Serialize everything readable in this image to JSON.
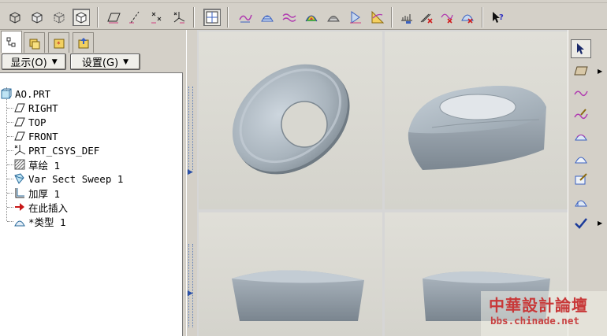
{
  "toolbar": {
    "icons": [
      "view-iso-icon",
      "view-shade-icon",
      "view-wire-icon",
      "view-solid-icon",
      "datum-plane-icon",
      "datum-axis-icon",
      "datum-point-icon",
      "datum-csys-icon",
      "select-window-icon",
      "curve-tool-icon",
      "surface-tool-icon",
      "wave-curve-icon",
      "color-sphere-icon",
      "render-icon",
      "measure-icon",
      "analysis-icon",
      "sensitivity-icon",
      "feasibility-icon",
      "optimize-icon",
      "delete-icon",
      "whats-this-icon"
    ]
  },
  "nav_tabs": [
    "model-tree-tab",
    "folder-browser-tab",
    "favorites-tab",
    "connections-tab"
  ],
  "model_tree": {
    "show_label": "显示(O)",
    "settings_label": "设置(G)",
    "root": "AO.PRT",
    "items": [
      {
        "label": "RIGHT",
        "icon": "datum-plane-icon"
      },
      {
        "label": "TOP",
        "icon": "datum-plane-icon"
      },
      {
        "label": "FRONT",
        "icon": "datum-plane-icon"
      },
      {
        "label": "PRT_CSYS_DEF",
        "icon": "csys-icon"
      },
      {
        "label": "草绘 1",
        "icon": "sketch-icon"
      },
      {
        "label": "Var Sect Sweep 1",
        "icon": "sweep-icon"
      },
      {
        "label": "加厚 1",
        "icon": "thicken-icon"
      },
      {
        "label": "在此插入",
        "icon": "insert-here-icon"
      },
      {
        "label": "*类型 1",
        "icon": "style-icon"
      }
    ]
  },
  "right_toolbar": {
    "icons": [
      "select-icon",
      "plane-icon",
      "curve-icon",
      "curve-edit-icon",
      "surface-icon",
      "boundary-icon",
      "surface-edit-icon",
      "style-surface-icon",
      "done-check-icon"
    ]
  },
  "watermark": {
    "title": "中華設計論壇",
    "url": "bbs.chinade.net"
  },
  "colors": {
    "chrome": "#d4d0c8",
    "viewport": "#dcdbd4",
    "model_gray": "#a9b4bd",
    "watermark": "#c83838"
  }
}
